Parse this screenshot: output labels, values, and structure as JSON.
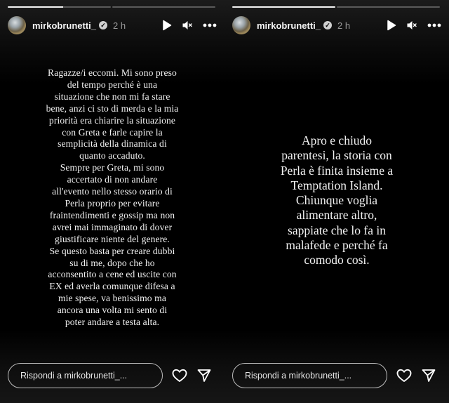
{
  "stories": [
    {
      "progress": [
        0.54,
        0
      ],
      "header": {
        "username": "mirkobrunetti_",
        "verified": true,
        "time": "2 h"
      },
      "text": "Ragazze/i eccomi. Mi sono preso\ndel tempo perché è una\nsituazione che non mi fa stare\nbene, anzi ci sto di merda e la mia\npriorità era chiarire la situazione\ncon Greta e farle capire la\nsemplicità della dinamica di\nquanto accaduto.\nSempre per Greta, mi sono\naccertato di non andare\nall'evento nello stesso orario di\nPerla proprio per evitare\nfraintendimenti e gossip ma non\navrei mai immaginato di dover\ngiustificare niente del genere.\nSe questo basta per creare dubbi\nsu di me, dopo che ho\nacconsentito a cene ed uscite con\nEX ed averla comunque difesa a\nmie spese, va benissimo ma\nancora una volta mi sento di\npoter andare a testa alta.",
      "reply_placeholder": "Rispondi a mirkobrunetti_..."
    },
    {
      "progress": [
        1,
        0
      ],
      "header": {
        "username": "mirkobrunetti_",
        "verified": true,
        "time": "2 h"
      },
      "text": "Apro e chiudo\nparentesi, la storia con\nPerla è finita insieme a\nTemptation Island.\nChiunque voglia\nalimentare altro,\nsappiate che lo fa in\nmalafede e perché fa\ncomodo così.",
      "reply_placeholder": "Rispondi a mirkobrunetti_..."
    }
  ],
  "icons": {
    "verified": "✓",
    "play": "play-icon",
    "mute": "speaker-muted-icon",
    "more": "more-horizontal-icon",
    "like": "heart-icon",
    "share": "send-icon"
  }
}
